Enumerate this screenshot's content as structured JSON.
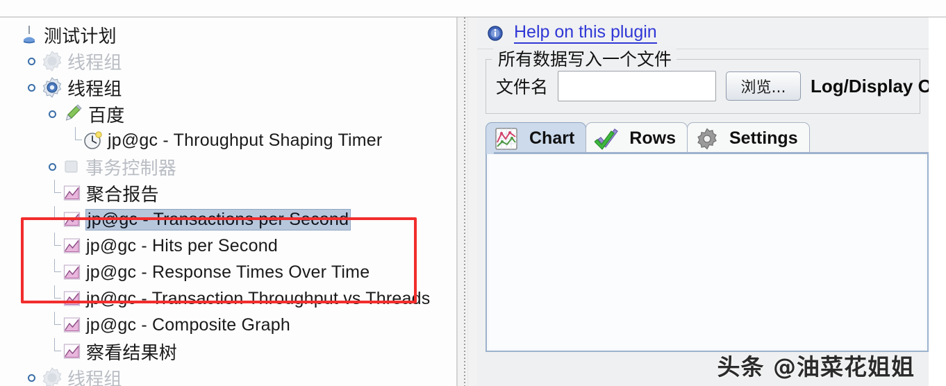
{
  "tree": {
    "items": [
      {
        "label": "测试计划",
        "icon": "test-plan-icon",
        "depth": 0,
        "state": "normal",
        "toggle": "none"
      },
      {
        "label": "线程组",
        "icon": "thread-group-disabled-icon",
        "depth": 1,
        "state": "disabled",
        "toggle": "collapsed"
      },
      {
        "label": "线程组",
        "icon": "thread-group-icon",
        "depth": 1,
        "state": "normal",
        "toggle": "expanded"
      },
      {
        "label": "百度",
        "icon": "http-sampler-icon",
        "depth": 2,
        "state": "normal",
        "toggle": "expanded"
      },
      {
        "label": "jp@gc - Throughput Shaping Timer",
        "icon": "timer-icon",
        "depth": 3,
        "state": "normal",
        "toggle": "leaf"
      },
      {
        "label": "事务控制器",
        "icon": "transaction-controller-icon",
        "depth": 2,
        "state": "disabled",
        "toggle": "collapsed"
      },
      {
        "label": "聚合报告",
        "icon": "listener-chart-icon",
        "depth": 2,
        "state": "normal",
        "toggle": "leaf"
      },
      {
        "label": "jp@gc - Transactions per Second",
        "icon": "listener-chart-icon",
        "depth": 2,
        "state": "selected",
        "toggle": "leaf"
      },
      {
        "label": "jp@gc - Hits per Second",
        "icon": "listener-chart-icon",
        "depth": 2,
        "state": "normal",
        "toggle": "leaf"
      },
      {
        "label": "jp@gc - Response Times Over Time",
        "icon": "listener-chart-icon",
        "depth": 2,
        "state": "normal",
        "toggle": "leaf"
      },
      {
        "label": "jp@gc - Transaction Throughput vs Threads",
        "icon": "listener-chart-icon",
        "depth": 2,
        "state": "normal",
        "toggle": "leaf"
      },
      {
        "label": "jp@gc - Composite Graph",
        "icon": "listener-chart-icon",
        "depth": 2,
        "state": "normal",
        "toggle": "leaf"
      },
      {
        "label": "察看结果树",
        "icon": "listener-chart-icon",
        "depth": 2,
        "state": "normal",
        "toggle": "leaf"
      },
      {
        "label": "线程组",
        "icon": "thread-group-disabled-icon",
        "depth": 1,
        "state": "disabled",
        "toggle": "collapsed"
      }
    ],
    "annotation": {
      "name": "red-highlight-box",
      "color": "#f22d2d",
      "encloses": [
        "jp@gc - Transactions per Second",
        "jp@gc - Hits per Second",
        "jp@gc - Response Times Over Time"
      ]
    },
    "selection_color": "#b6c7dc"
  },
  "right_panel": {
    "help": {
      "label": "Help on this plugin",
      "icon": "info-icon",
      "color": "#2f37d6"
    },
    "file_group": {
      "title": "所有数据写入一个文件",
      "file_label": "文件名",
      "file_value": "",
      "file_placeholder": "",
      "browse_label": "浏览...",
      "log_display_label": "Log/Display On"
    },
    "tabs": [
      {
        "label": "Chart",
        "icon": "chart-icon",
        "active": true
      },
      {
        "label": "Rows",
        "icon": "checkmarks-icon",
        "active": false
      },
      {
        "label": "Settings",
        "icon": "gear-icon",
        "active": false
      }
    ],
    "chart_area": {
      "content": ""
    }
  },
  "watermark": {
    "text": "头条 @油菜花姐姐"
  }
}
